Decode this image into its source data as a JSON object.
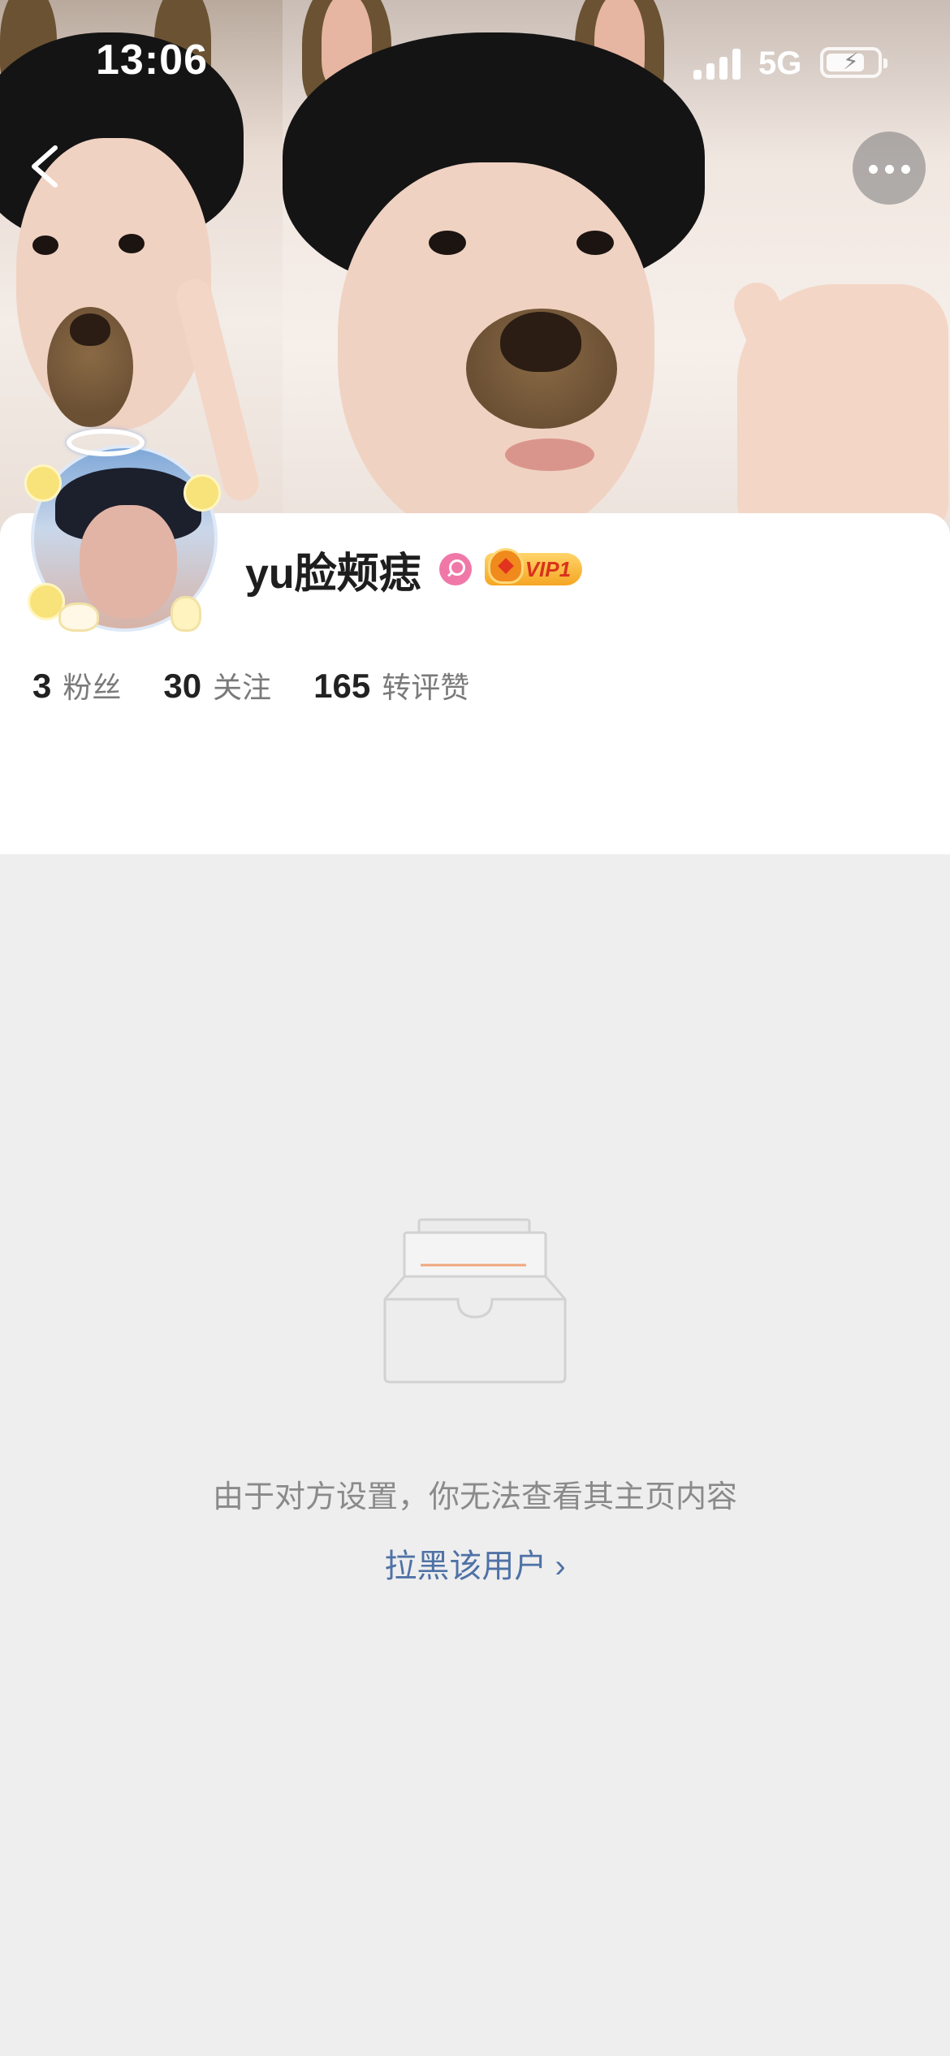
{
  "status_bar": {
    "time": "13:06",
    "network": "5G"
  },
  "profile": {
    "username": "yu脸颊痣",
    "vip_label": "VIP1",
    "stats": [
      {
        "value": "3",
        "label": "粉丝"
      },
      {
        "value": "30",
        "label": "关注"
      },
      {
        "value": "165",
        "label": "转评赞"
      }
    ]
  },
  "empty_state": {
    "message": "由于对方设置，你无法查看其主页内容",
    "block_link": "拉黑该用户",
    "chevron": "›"
  },
  "colors": {
    "link": "#4f72a6",
    "page_bg": "#eeeeee",
    "gender_badge": "#f078a8",
    "vip_badge": "#f5a623"
  },
  "icons": [
    "back-arrow-icon",
    "more-icon",
    "female-gender-icon",
    "vip-crown-icon",
    "empty-box-icon"
  ]
}
